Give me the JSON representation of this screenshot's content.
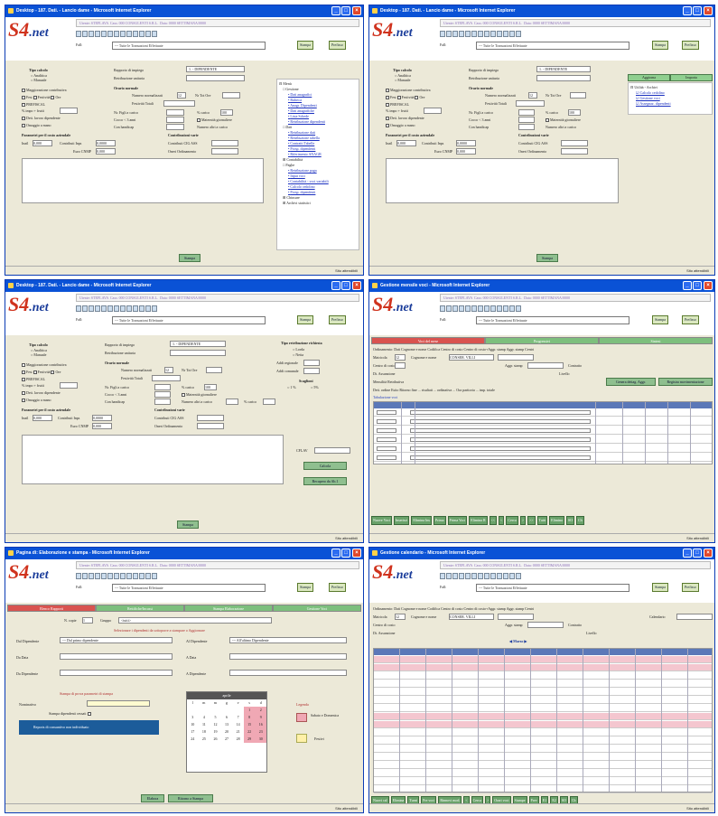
{
  "windows": [
    {
      "title": "Desktop - 187. Dati. - Lancio dame - Microsoft Internet Explorer",
      "info": {
        "utente": "Utente",
        "utente_val": "STEFLAVA",
        "cass_lbl": "Cass:",
        "cass_val": "000 CONSULENTI S.R.L.",
        "data_lbl": "Data:",
        "data_val": "0000 SETTIMANA/0000"
      },
      "filter_label": "Fall:",
      "filter_value": "--- Tutte le Transazioni Effettuate",
      "btn_a": "Stampa",
      "btn_b": "Prefisso",
      "status": "",
      "zone": "Sito attendibili",
      "tipo_calcolo": "Tipo calcolo",
      "opt1": "Analitica",
      "opt2": "Manuale",
      "rapporto": "Rapporto di impiego",
      "rapporto_val": "1. - DIPENDENTE",
      "retribuzione": "Retribuzione unitaria",
      "checks": [
        "Maggiorazione contributiva",
        "Fest",
        "Festività",
        "Ore"
      ],
      "prefiscal": "PREFISCAL",
      "orario": "Orario normale",
      "ore_lbl": "Numero normalizzati",
      "ore_val": "12",
      "nr_tot": "Nr Tot Ore",
      "festivita": "Festività Totali",
      "imp_lbl": "% impo + frutti",
      "dett": "Dett. lavoro dipendente",
      "omaggio": "Omaggio a mano",
      "figli": "Nr. Figli a carico",
      "pc": "% carico",
      "pc_val": "100",
      "comp": "Cocco < 3 anni",
      "maternita": "Maternità giornaliere",
      "handicap": "Con handicap",
      "altri": "Numero altri a carico",
      "par_irpef": "Parametri per il costo aziendale",
      "contrib_varie": "Contribuzioni varie",
      "inail": "Inail",
      "inail_val": "0,000",
      "contrib_inps": "Contributi Inps",
      "inps_val": "0,0000",
      "contrib_ass": "Contributi CIG ASS",
      "euro_cnp": "Euro CNMP",
      "cnp_val": "0,000",
      "oneri": "Oneri Ordinamento",
      "footer_btn": "Stampa",
      "tree": [
        "Menù",
        "Gestione",
        "Dati anagrafici",
        "Rubrica",
        "Anagr. Dipendenti",
        "Dati anagrafiche",
        "Lista Schede",
        "Retribuzione dipendenti",
        "Dati",
        "Retribuzione dati",
        "Retribuzione tabella",
        "Contratti Tabelle",
        "Prosp. dipendenti",
        "Riferimento ANAGR",
        "Contabilità",
        "Paghe",
        "Retribuzione paga",
        "Input voci",
        "Contabilità - voci variabili",
        "Calcolo cedolino",
        "Prosp. dipendenti",
        "Chiusure",
        "Archivi statistici"
      ]
    },
    {
      "title": "Desktop - 187. Dati. - Lancio dame - Microsoft Internet Explorer",
      "side_tabs": [
        "Aggiorna",
        "Importa"
      ],
      "side_items": [
        "Utilità - Archivi",
        "Calcolo cedolino",
        "Gestione voci",
        "Assegnaz. dipendenti"
      ]
    },
    {
      "title": "Desktop - 187. Dati. - Lancio dame - Microsoft Internet Explorer",
      "tipo_retr": "Tipo retribuzione richiesta",
      "lorda": "Lorda",
      "netta": "Netta",
      "addr_reg": "Addi regionale",
      "addr_com": "Addi comunale",
      "scaglioni": "Scaglioni",
      "s1": "1 %",
      "s2": "5%",
      "pc2": "% carico",
      "cflav": "CFLAV",
      "calcola": "Calcola",
      "recupero": "Recupero da Ab.1"
    },
    {
      "title": "Gestione mensile voci - Microsoft Internet Explorer",
      "tabs": [
        "Voci del mese",
        "Progressivi",
        "Sintesi"
      ],
      "row1": "Ordinamento: Dati  Cognome e nome  Codifica  Centro di costo  Centro di costo+Aggr. stamp  Aggr. stamp  Centri",
      "matricola_lbl": "Matricola",
      "matricola_val": "12",
      "cognome_lbl": "Cognome e nome",
      "cognome_val": "CONSER. VILLI",
      "centro_lbl": "Centro di costo",
      "aggr_lbl": "Aggr. stamp",
      "contratto": "Contratto",
      "dt_lbl": "Dt. Assunzione",
      "livello": "Livello",
      "mensil": "Mensilità Retributiva",
      "dett_row": "Dett. ordine  Esito  Ritorno fine  ...  risultati  ...  ordinativa  ...  Ora paritoria  ...  imp. totale",
      "tot": "Tabulazione voci",
      "grid_rows": 6,
      "bottom_btns": [
        "Nuove Voci",
        "Inserisci",
        "Elimina Ins",
        "Prima",
        "Prima Voci",
        "Elimina R",
        "<<",
        "<",
        "Cerca",
        ">",
        ">>",
        "Tutti",
        "Elimina",
        "SO",
        "Ch"
      ],
      "genera": "Genera dettag. Aggr.",
      "registra": "Registra movimentazione"
    },
    {
      "title": "Pagina di: Elaborazione e stampa - Microsoft Internet Explorer",
      "tabs": [
        "Elenco Rapporti",
        "Rettifiche/Incassi",
        "Stampa Elaborazione",
        "Gestione Voci"
      ],
      "row_lbl": "N. copie",
      "row_val": "1",
      "gruppi": "Gruppo",
      "gruppi_val": "<tutti>",
      "sel_lbl": "Selezionare i dipendenti da sottoporre a stampare o Aggiornare",
      "dal_lbl": "Dal Dipendente",
      "dal_val": "--- Dal primo dipendente",
      "al_lbl": "Al Dipendente",
      "al_val": "--- All'ultimo Dipendente",
      "dadata": "Da Data",
      "adata": "A Data",
      "dadip": "Da Dipendente",
      "adip": "A Dipendente",
      "stampa_title": "Stampa di prova parametri di stampa",
      "nominativo": "Nominativo",
      "stampa_dip": "Stampa dipendenti cessati",
      "msg": "Reports di consuntivo non individuato",
      "cal_month": "aprile",
      "days": [
        "l",
        "m",
        "m",
        "g",
        "v",
        "s",
        "d"
      ],
      "legend": "Legenda",
      "leg1": "Sabato e Domenica",
      "leg2": "Festivi",
      "btn1": "Elabora",
      "btn2": "Ritorno a Stampa"
    },
    {
      "title": "Gestione calendario - Microsoft Internet Explorer",
      "month_nav": "Marzo",
      "calendario": "Calendario",
      "bottom_btns": [
        "Nuovi cal",
        "Elimina",
        "Turni",
        "Pre voci",
        "Rinnovi mod.",
        "<",
        "Cerca",
        ">",
        "Orari voci",
        "Stampe",
        "Prev",
        "E1",
        "E2",
        "SO",
        "Ch"
      ]
    }
  ]
}
